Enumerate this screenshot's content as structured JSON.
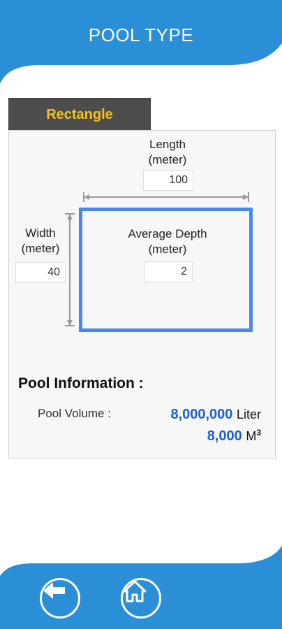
{
  "header": {
    "title": "POOL TYPE"
  },
  "tab": {
    "label": "Rectangle"
  },
  "form": {
    "length": {
      "label_line1": "Length",
      "label_line2": "(meter)",
      "value": "100"
    },
    "width": {
      "label_line1": "Width",
      "label_line2": "(meter)",
      "value": "40"
    },
    "depth": {
      "label_line1": "Average Depth",
      "label_line2": "(meter)",
      "value": "2"
    }
  },
  "info": {
    "title": "Pool Information :",
    "volume_label": "Pool Volume :",
    "volume_liters": "8,000,000",
    "liters_unit": "Liter",
    "volume_m3": "8,000",
    "m3_unit": "M",
    "m3_sup": "3"
  },
  "footer": {
    "back_icon": "back-arrow-icon",
    "home_icon": "home-icon"
  },
  "colors": {
    "brand_blue": "#2b8fd8",
    "accent_yellow": "#f2c31b",
    "value_blue": "#1a5fd6",
    "pool_outline": "#4a86f0"
  }
}
